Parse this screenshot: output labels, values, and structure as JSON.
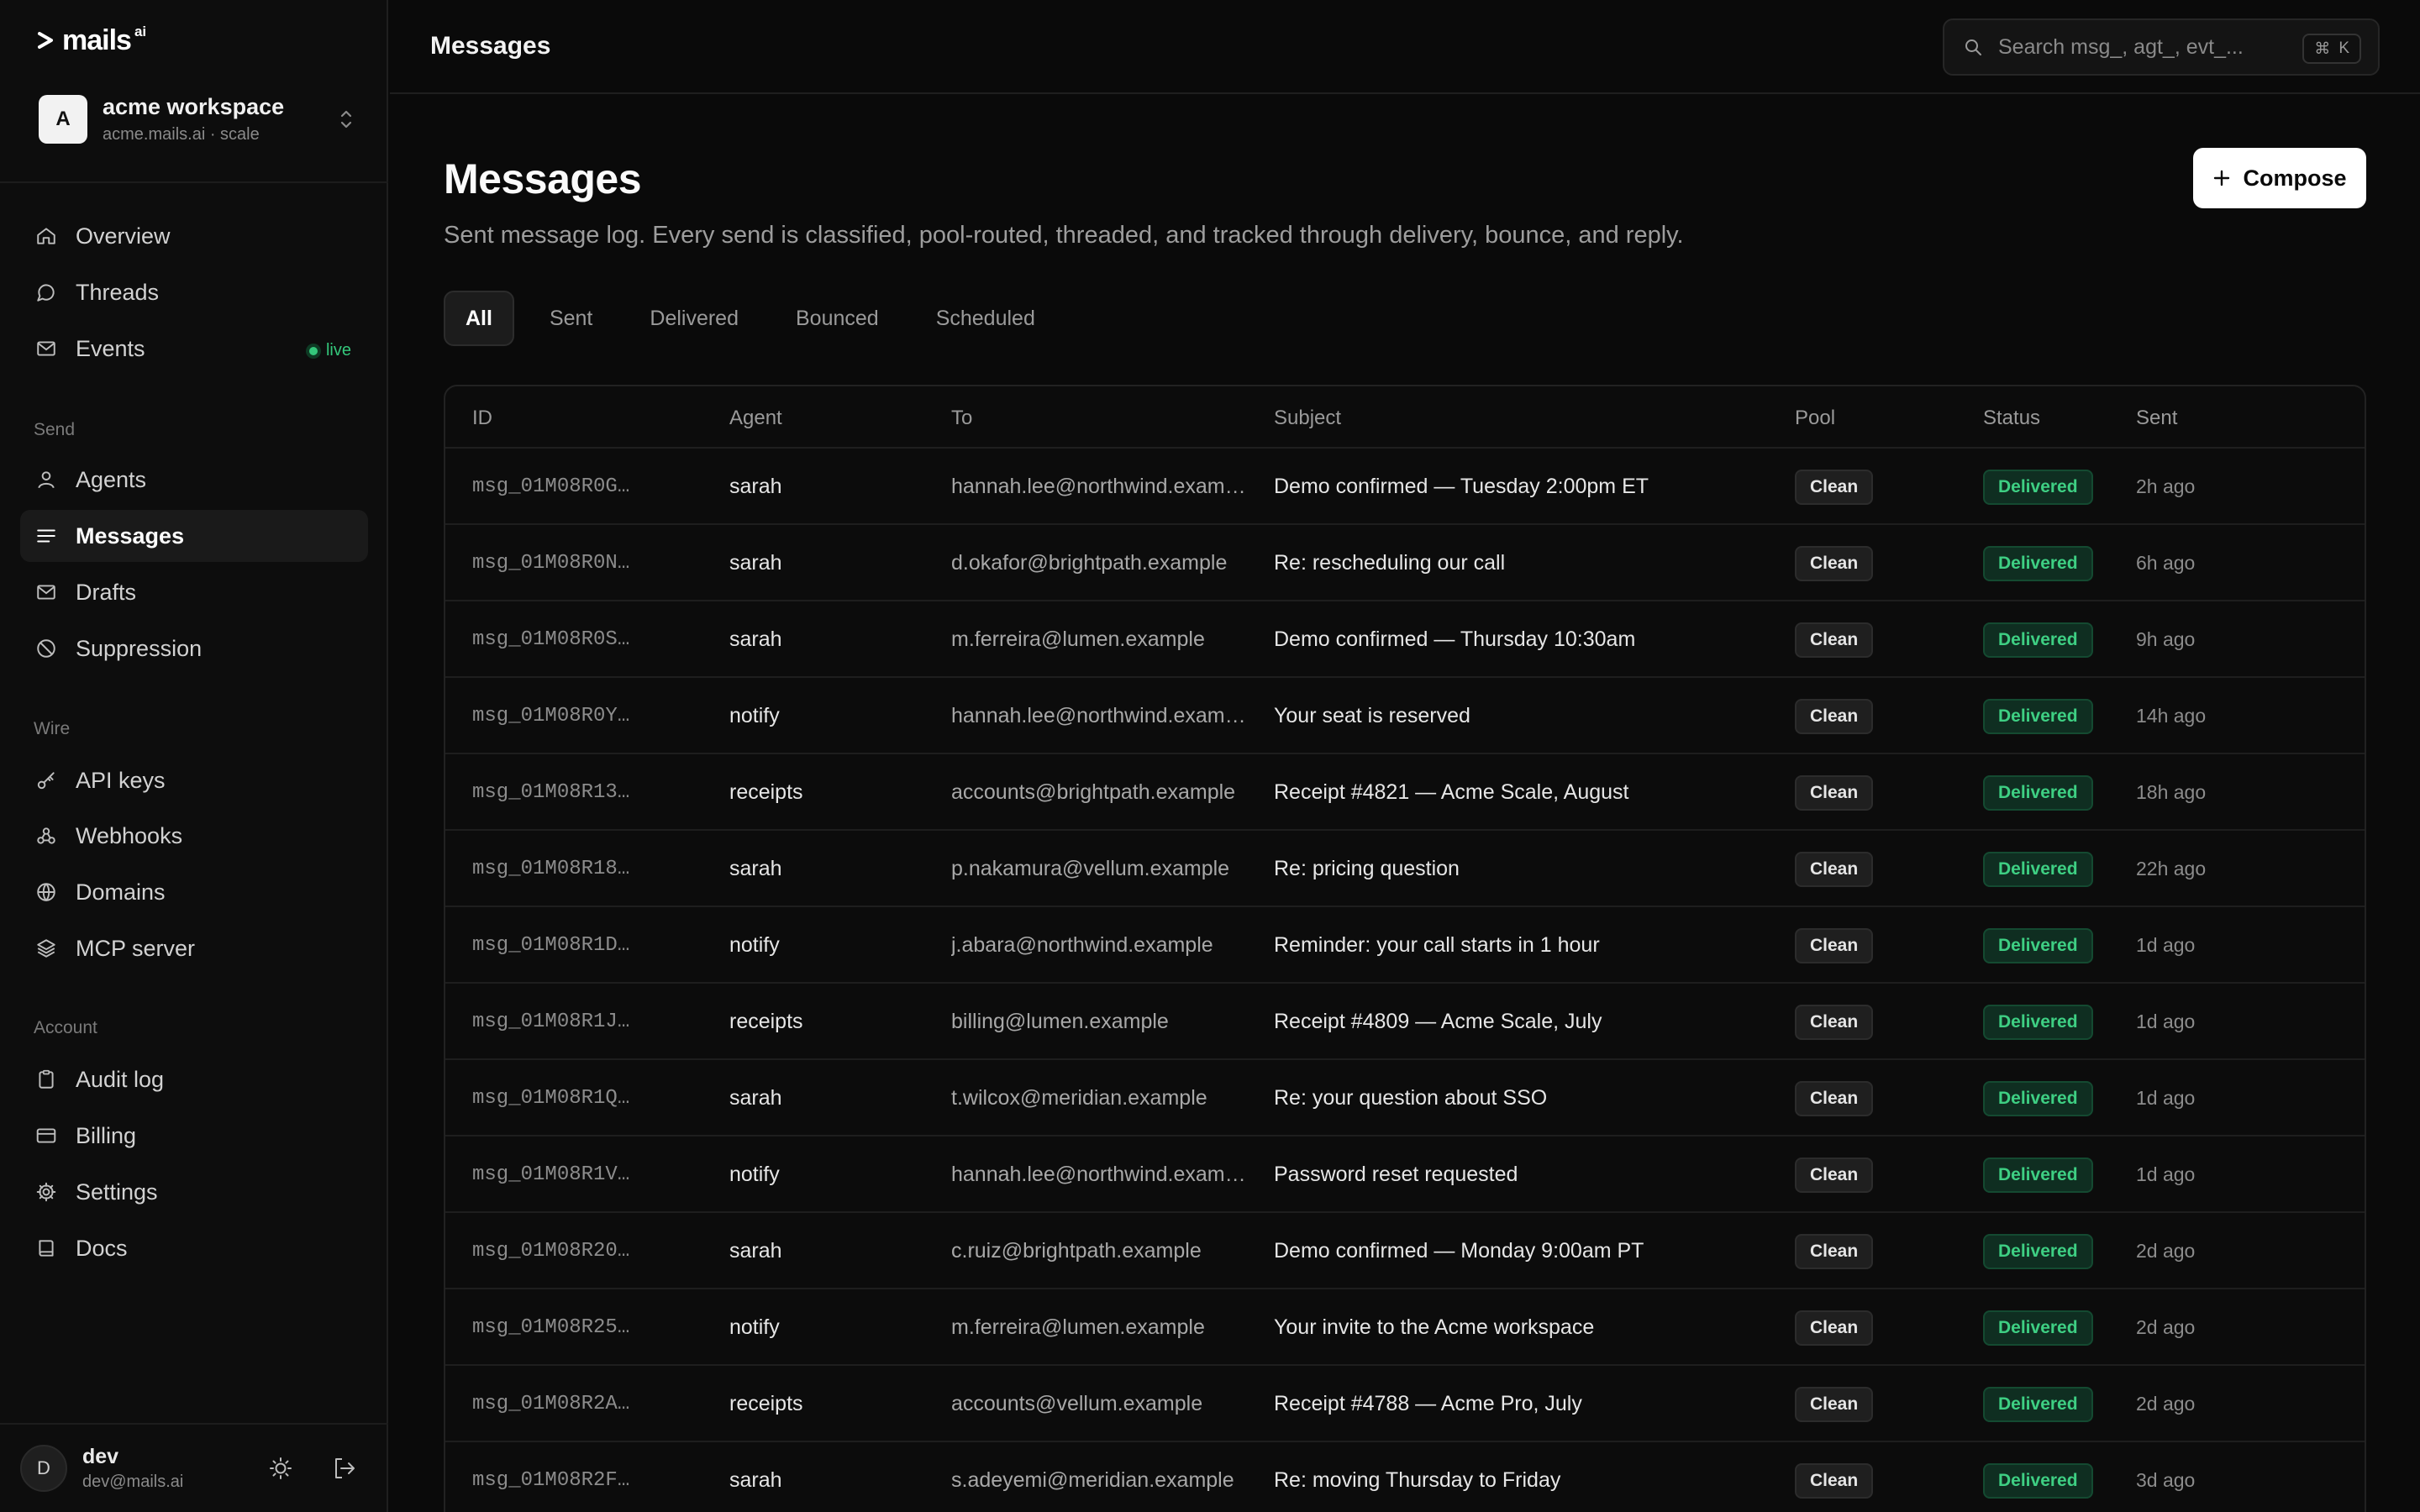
{
  "brand": {
    "name": "mails",
    "suffix": "ai"
  },
  "workspace": {
    "initial": "A",
    "name": "acme workspace",
    "subtitle": "acme.mails.ai · scale"
  },
  "nav": {
    "main": [
      {
        "label": "Overview",
        "icon": "home-icon"
      },
      {
        "label": "Threads",
        "icon": "chat-bubble-icon"
      },
      {
        "label": "Events",
        "icon": "mail-icon",
        "badge": "live"
      }
    ],
    "send_title": "Send",
    "send": [
      {
        "label": "Agents",
        "icon": "user-icon"
      },
      {
        "label": "Messages",
        "icon": "list-icon",
        "active": true
      },
      {
        "label": "Drafts",
        "icon": "draft-mail-icon"
      },
      {
        "label": "Suppression",
        "icon": "ban-icon"
      }
    ],
    "wire_title": "Wire",
    "wire": [
      {
        "label": "API keys",
        "icon": "key-icon"
      },
      {
        "label": "Webhooks",
        "icon": "webhook-icon"
      },
      {
        "label": "Domains",
        "icon": "globe-icon"
      },
      {
        "label": "MCP server",
        "icon": "layers-icon"
      }
    ],
    "account_title": "Account",
    "account": [
      {
        "label": "Audit log",
        "icon": "clipboard-icon"
      },
      {
        "label": "Billing",
        "icon": "credit-card-icon"
      },
      {
        "label": "Settings",
        "icon": "gear-icon"
      },
      {
        "label": "Docs",
        "icon": "book-icon"
      }
    ]
  },
  "user": {
    "initial": "D",
    "name": "dev",
    "email": "dev@mails.ai"
  },
  "topbar": {
    "title": "Messages",
    "search_placeholder": "Search msg_, agt_, evt_...",
    "shortcut_symbol": "⌘",
    "shortcut_key": "K"
  },
  "page": {
    "title": "Messages",
    "description": "Sent message log. Every send is classified, pool-routed, threaded, and tracked through delivery, bounce, and reply.",
    "compose_label": "Compose",
    "tabs": [
      "All",
      "Sent",
      "Delivered",
      "Bounced",
      "Scheduled"
    ],
    "active_tab": "All"
  },
  "table": {
    "columns": [
      "ID",
      "Agent",
      "To",
      "Subject",
      "Pool",
      "Status",
      "Sent"
    ],
    "rows": [
      {
        "id": "msg_01M08R0G…",
        "agent": "sarah",
        "to": "hannah.lee@northwind.exam…",
        "subject": "Demo confirmed — Tuesday 2:00pm ET",
        "pool": "Clean",
        "status": "Delivered",
        "sent": "2h ago"
      },
      {
        "id": "msg_01M08R0N…",
        "agent": "sarah",
        "to": "d.okafor@brightpath.example",
        "subject": "Re: rescheduling our call",
        "pool": "Clean",
        "status": "Delivered",
        "sent": "6h ago"
      },
      {
        "id": "msg_01M08R0S…",
        "agent": "sarah",
        "to": "m.ferreira@lumen.example",
        "subject": "Demo confirmed — Thursday 10:30am",
        "pool": "Clean",
        "status": "Delivered",
        "sent": "9h ago"
      },
      {
        "id": "msg_01M08R0Y…",
        "agent": "notify",
        "to": "hannah.lee@northwind.exam…",
        "subject": "Your seat is reserved",
        "pool": "Clean",
        "status": "Delivered",
        "sent": "14h ago"
      },
      {
        "id": "msg_01M08R13…",
        "agent": "receipts",
        "to": "accounts@brightpath.example",
        "subject": "Receipt #4821 — Acme Scale, August",
        "pool": "Clean",
        "status": "Delivered",
        "sent": "18h ago"
      },
      {
        "id": "msg_01M08R18…",
        "agent": "sarah",
        "to": "p.nakamura@vellum.example",
        "subject": "Re: pricing question",
        "pool": "Clean",
        "status": "Delivered",
        "sent": "22h ago"
      },
      {
        "id": "msg_01M08R1D…",
        "agent": "notify",
        "to": "j.abara@northwind.example",
        "subject": "Reminder: your call starts in 1 hour",
        "pool": "Clean",
        "status": "Delivered",
        "sent": "1d ago"
      },
      {
        "id": "msg_01M08R1J…",
        "agent": "receipts",
        "to": "billing@lumen.example",
        "subject": "Receipt #4809 — Acme Scale, July",
        "pool": "Clean",
        "status": "Delivered",
        "sent": "1d ago"
      },
      {
        "id": "msg_01M08R1Q…",
        "agent": "sarah",
        "to": "t.wilcox@meridian.example",
        "subject": "Re: your question about SSO",
        "pool": "Clean",
        "status": "Delivered",
        "sent": "1d ago"
      },
      {
        "id": "msg_01M08R1V…",
        "agent": "notify",
        "to": "hannah.lee@northwind.exam…",
        "subject": "Password reset requested",
        "pool": "Clean",
        "status": "Delivered",
        "sent": "1d ago"
      },
      {
        "id": "msg_01M08R20…",
        "agent": "sarah",
        "to": "c.ruiz@brightpath.example",
        "subject": "Demo confirmed — Monday 9:00am PT",
        "pool": "Clean",
        "status": "Delivered",
        "sent": "2d ago"
      },
      {
        "id": "msg_01M08R25…",
        "agent": "notify",
        "to": "m.ferreira@lumen.example",
        "subject": "Your invite to the Acme workspace",
        "pool": "Clean",
        "status": "Delivered",
        "sent": "2d ago"
      },
      {
        "id": "msg_01M08R2A…",
        "agent": "receipts",
        "to": "accounts@vellum.example",
        "subject": "Receipt #4788 — Acme Pro, July",
        "pool": "Clean",
        "status": "Delivered",
        "sent": "2d ago"
      },
      {
        "id": "msg_01M08R2F…",
        "agent": "sarah",
        "to": "s.adeyemi@meridian.example",
        "subject": "Re: moving Thursday to Friday",
        "pool": "Clean",
        "status": "Delivered",
        "sent": "3d ago"
      }
    ]
  },
  "colors": {
    "accent_green": "#3ecf83",
    "background": "#0a0a0a",
    "sidebar": "#0d0d0d"
  }
}
